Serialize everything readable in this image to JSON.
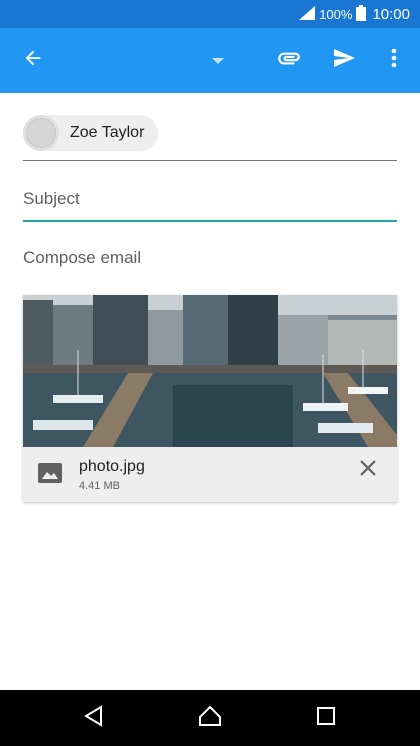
{
  "status_bar": {
    "battery": "100%",
    "time": "10:00"
  },
  "recipient": {
    "name": "Zoe Taylor"
  },
  "subject": {
    "placeholder": "Subject"
  },
  "compose": {
    "placeholder": "Compose email"
  },
  "attachment": {
    "file_name": "photo.jpg",
    "file_size": "4.41 MB"
  },
  "colors": {
    "status_bar": "#1976d2",
    "app_bar": "#2196f3",
    "accent": "#26a69a",
    "card": "#eeeeee"
  },
  "icons": {
    "app_bar": [
      "back-arrow-icon",
      "dropdown-arrow-icon",
      "attach-icon",
      "send-icon",
      "more-vert-icon"
    ],
    "nav": [
      "nav-back-icon",
      "nav-home-icon",
      "nav-recents-icon"
    ]
  }
}
